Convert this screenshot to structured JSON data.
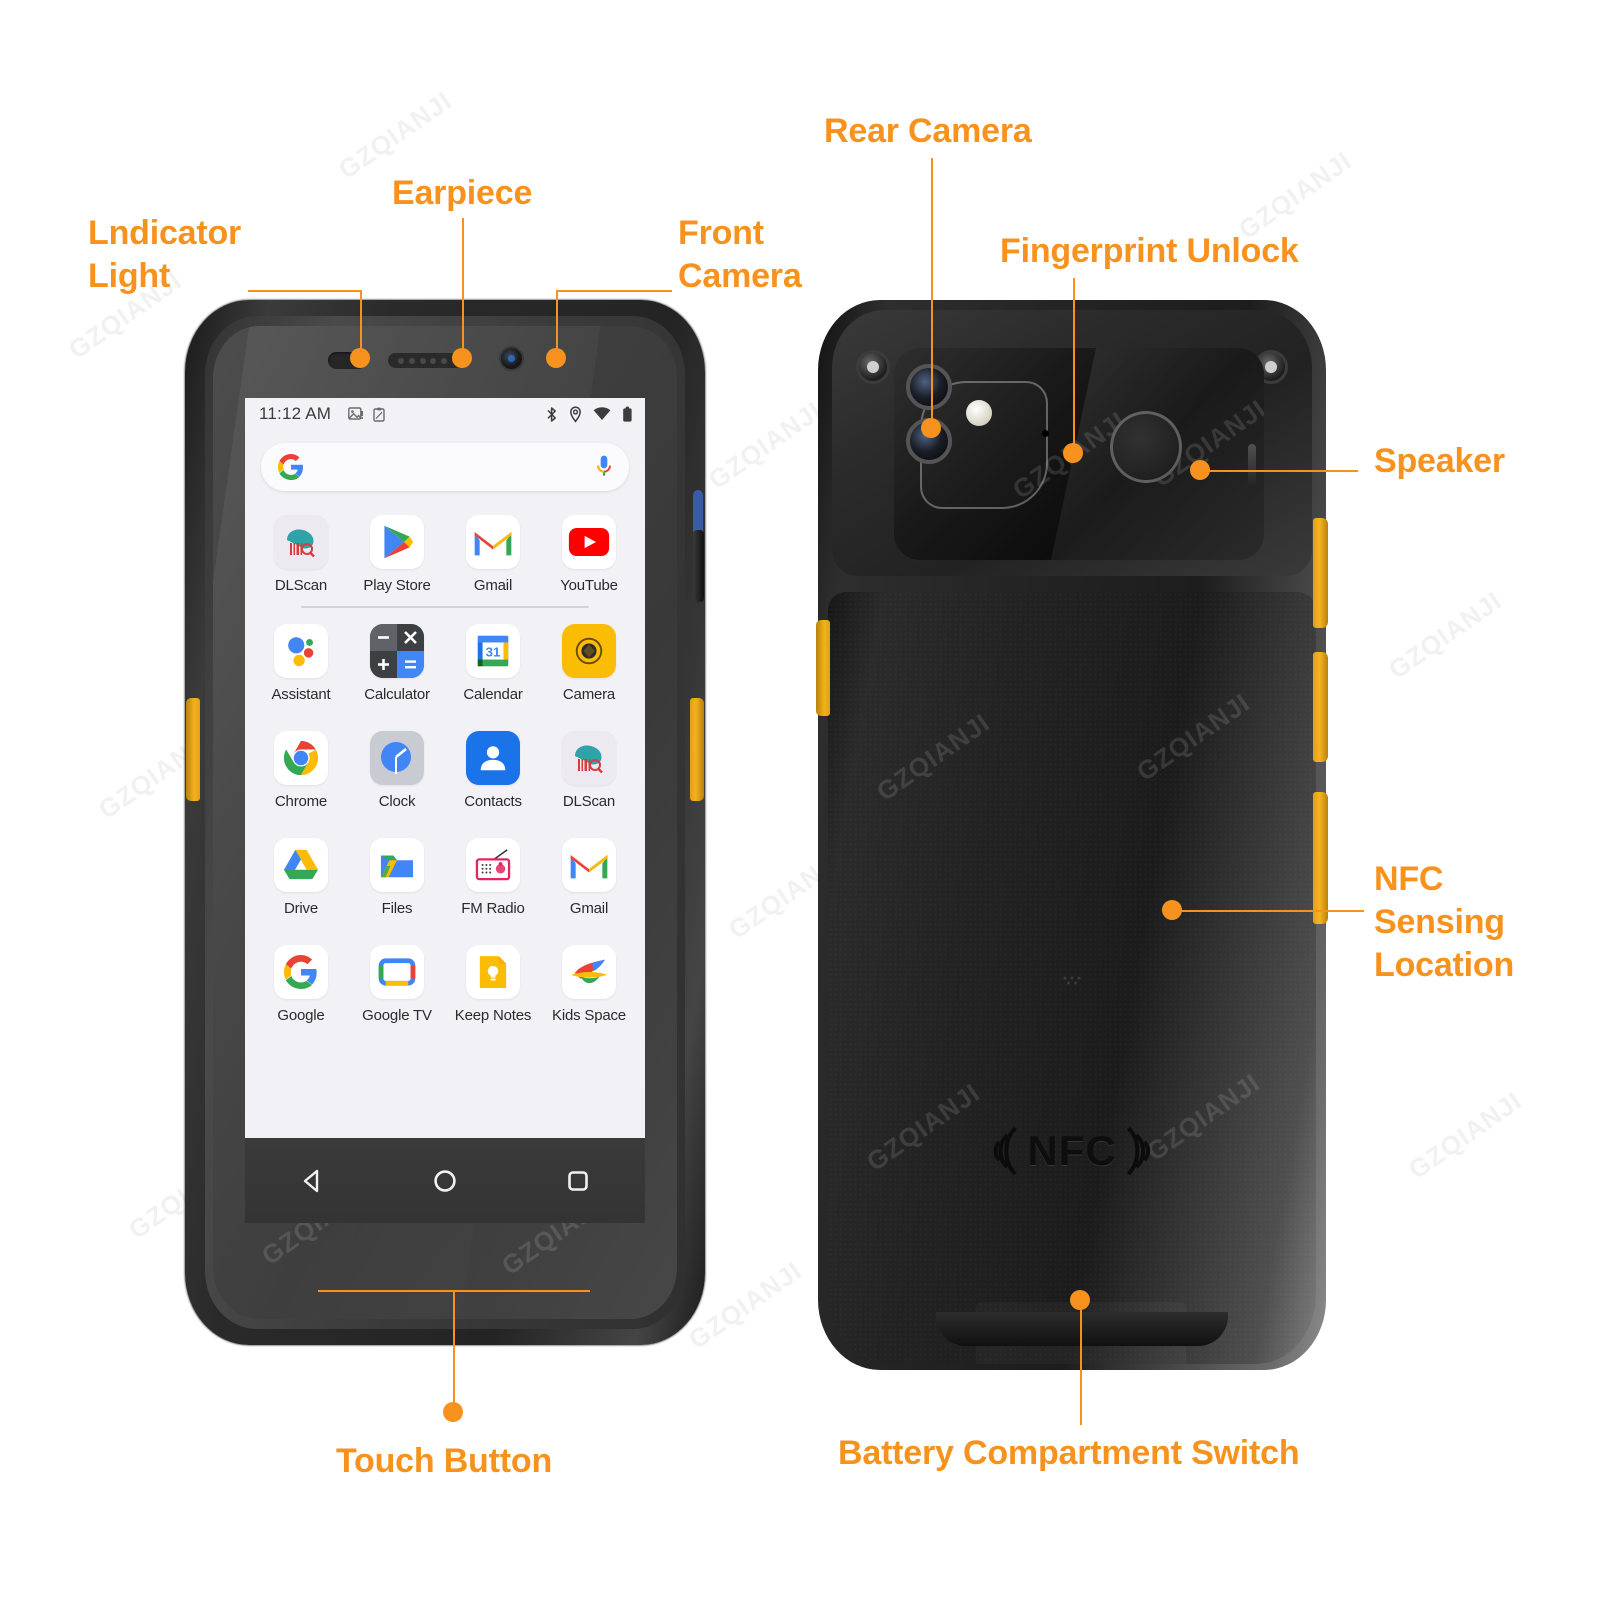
{
  "diagram": {
    "title": "Rugged Android PDA front and back annotated view",
    "accent_color": "#F7921E",
    "watermark_text": "GZQIANJI"
  },
  "callouts": {
    "indicator_light": "Lndicator\nLight",
    "earpiece": "Earpiece",
    "front_camera": "Front\nCamera",
    "rear_camera": "Rear Camera",
    "fingerprint_unlock": "Fingerprint Unlock",
    "speaker": "Speaker",
    "nfc_sensing_location": "NFC\nSensing\nLocation",
    "touch_button": "Touch Button",
    "battery_switch": "Battery Compartment Switch"
  },
  "phone_screen": {
    "status_bar": {
      "time": "11:12 AM",
      "left_icons": [
        "image-icon",
        "clipboard-icon"
      ],
      "right_icons": [
        "bluetooth-icon",
        "location-icon",
        "wifi-icon",
        "battery-icon"
      ]
    },
    "search_bar": {
      "left_icon": "google-g-icon",
      "right_icon": "microphone-icon",
      "placeholder": ""
    },
    "app_rows": [
      [
        {
          "label": "DLScan",
          "icon": "dlscan-icon"
        },
        {
          "label": "Play Store",
          "icon": "play-store-icon"
        },
        {
          "label": "Gmail",
          "icon": "gmail-icon"
        },
        {
          "label": "YouTube",
          "icon": "youtube-icon"
        }
      ],
      [
        {
          "label": "Assistant",
          "icon": "assistant-icon"
        },
        {
          "label": "Calculator",
          "icon": "calculator-icon"
        },
        {
          "label": "Calendar",
          "icon": "calendar-icon"
        },
        {
          "label": "Camera",
          "icon": "camera-icon"
        }
      ],
      [
        {
          "label": "Chrome",
          "icon": "chrome-icon"
        },
        {
          "label": "Clock",
          "icon": "clock-icon"
        },
        {
          "label": "Contacts",
          "icon": "contacts-icon"
        },
        {
          "label": "DLScan",
          "icon": "dlscan-icon"
        }
      ],
      [
        {
          "label": "Drive",
          "icon": "drive-icon"
        },
        {
          "label": "Files",
          "icon": "files-icon"
        },
        {
          "label": "FM Radio",
          "icon": "fm-radio-icon"
        },
        {
          "label": "Gmail",
          "icon": "gmail-icon"
        }
      ],
      [
        {
          "label": "Google",
          "icon": "google-icon"
        },
        {
          "label": "Google TV",
          "icon": "google-tv-icon"
        },
        {
          "label": "Keep Notes",
          "icon": "keep-notes-icon"
        },
        {
          "label": "Kids Space",
          "icon": "kids-space-icon"
        }
      ]
    ],
    "nav_bar": [
      "back-icon",
      "home-icon",
      "recents-icon"
    ],
    "calendar_day": "31"
  },
  "back_device": {
    "nfc_label": "NFC",
    "pogo_pin_count": 8,
    "lock_icons": [
      "unlock-icon",
      "slide-arrow-icon",
      "lock-icon"
    ]
  }
}
